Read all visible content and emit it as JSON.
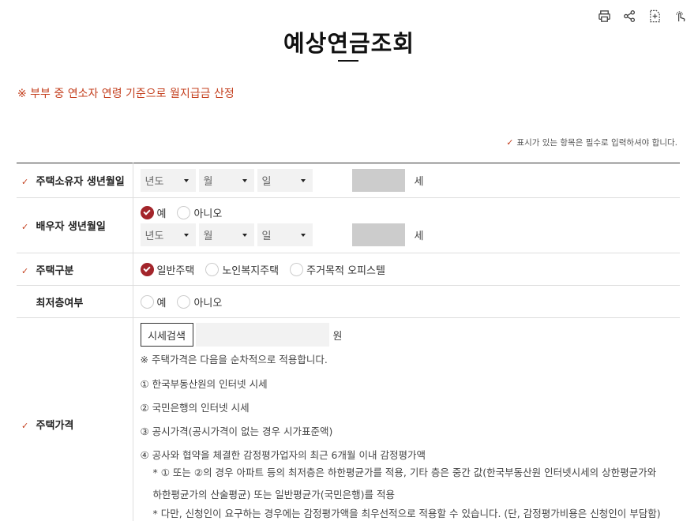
{
  "toolbar": {
    "icons": [
      "print-icon",
      "share-icon",
      "document-icon",
      "touch-icon"
    ]
  },
  "page": {
    "title": "예상연금조회"
  },
  "notice": "※ 부부 중 연소자 연령 기준으로 월지급금 산정",
  "required_note": "표시가 있는 항목은 필수로 입력하셔야 합니다.",
  "rows": {
    "owner_birth": {
      "label": "주택소유자 생년월일",
      "year": "년도",
      "month": "월",
      "day": "일",
      "age_unit": "세"
    },
    "spouse_birth": {
      "label": "배우자 생년월일",
      "yes": "예",
      "no": "아니오",
      "year": "년도",
      "month": "월",
      "day": "일",
      "age_unit": "세"
    },
    "house_type": {
      "label": "주택구분",
      "options": [
        "일반주택",
        "노인복지주택",
        "주거목적 오피스텔"
      ]
    },
    "lowest_floor": {
      "label": "최저층여부",
      "yes": "예",
      "no": "아니오"
    },
    "house_price": {
      "label": "주택가격",
      "search_button": "시세검색",
      "unit": "원",
      "lines": [
        "※ 주택가격은 다음을 순차적으로 적용합니다.",
        "① 한국부동산원의 인터넷 시세",
        "② 국민은행의 인터넷 시세",
        "③ 공시가격(공시가격이 없는 경우 시가표준액)",
        "④ 공사와 협약을 체결한 감정평가업자의 최근 6개월 이내 감정평가액",
        "* ① 또는 ②의 경우 아파트 등의 최저층은 하한평균가를 적용, 기타 층은 중간 값(한국부동산원 인터넷시세의 상한평균가와",
        "하한평균가의 산술평균) 또는 일반평균가(국민은행)를 적용",
        "* 다만, 신청인이 요구하는 경우에는 감정평가액을 최우선적으로 적용할 수 있습니다. (단, 감정평가비용은 신청인이 부담함)"
      ]
    }
  },
  "colors": {
    "accent": "#c4401f",
    "radio_checked": "#a3252b"
  }
}
